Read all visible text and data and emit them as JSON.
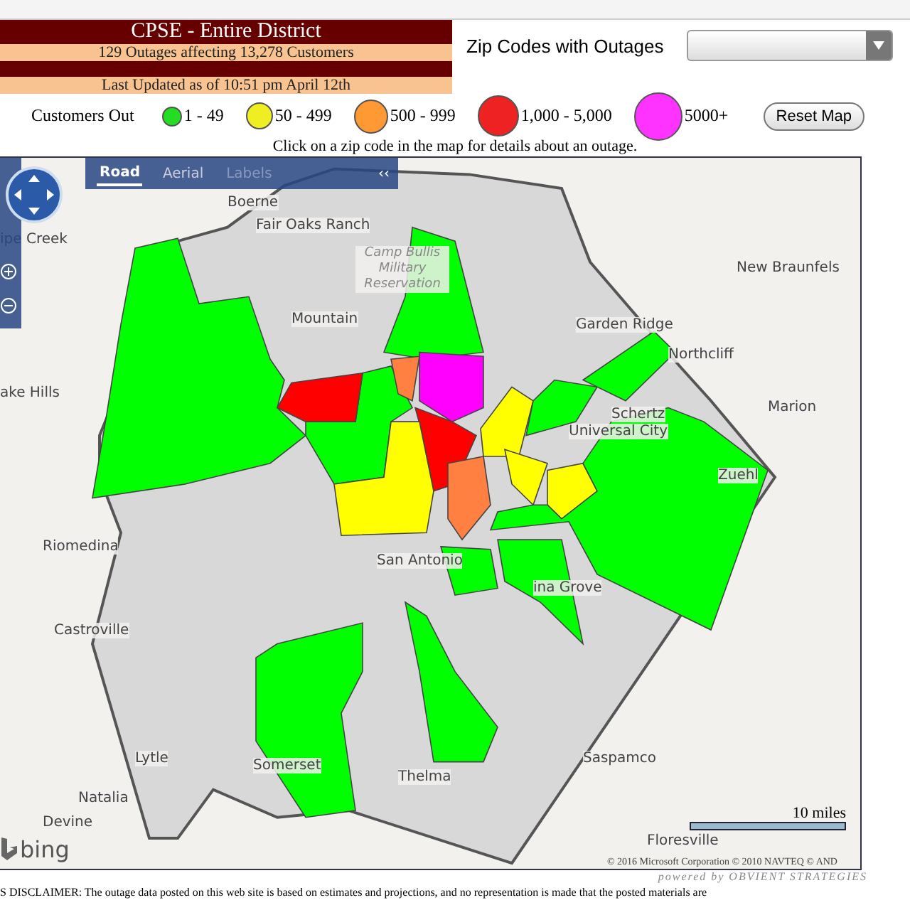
{
  "header": {
    "title": "CPSE - Entire District",
    "summary": "129 Outages affecting 13,278 Customers",
    "updated": "Last Updated as of 10:51 pm April 12th"
  },
  "zip_filter": {
    "label": "Zip Codes with Outages"
  },
  "legend": {
    "label": "Customers Out",
    "items": [
      {
        "label": "1 - 49",
        "color": "#22dd22"
      },
      {
        "label": "50 - 499",
        "color": "#eeee22"
      },
      {
        "label": "500 - 999",
        "color": "#ff9933"
      },
      {
        "label": "1,000 - 5,000",
        "color": "#ee2222"
      },
      {
        "label": "5000+",
        "color": "#ff33ff"
      }
    ]
  },
  "reset_button": "Reset Map",
  "instruction": "Click on a zip code in the map for details about an outage.",
  "map": {
    "tabs": [
      {
        "label": "Road",
        "selected": true
      },
      {
        "label": "Aerial",
        "selected": false
      },
      {
        "label": "Labels",
        "selected": false
      }
    ],
    "collapse": "‹‹",
    "zones": [
      {
        "color": "#00ff00"
      },
      {
        "color": "#00ff00"
      },
      {
        "color": "#00ff00"
      },
      {
        "color": "#ff0000"
      },
      {
        "color": "#ff8040"
      },
      {
        "color": "#ff00ff"
      },
      {
        "color": "#ff0000"
      },
      {
        "color": "#ffff00"
      },
      {
        "color": "#ff8040"
      },
      {
        "color": "#ffff00"
      },
      {
        "color": "#ffff00"
      },
      {
        "color": "#ffff00"
      },
      {
        "color": "#00ff00"
      },
      {
        "color": "#00ff00"
      },
      {
        "color": "#00ff00"
      },
      {
        "color": "#00ff00"
      },
      {
        "color": "#00ff00"
      },
      {
        "color": "#00ff00"
      },
      {
        "color": "#00ff00"
      }
    ],
    "labels": [
      "Boerne",
      "ipe Creek",
      "Fair Oaks Ranch",
      "Camp Bullis Military Reservation",
      "Mountain",
      "Garden Ridge",
      "New Braunfels",
      "Northcliff",
      "Marion",
      "Schertz",
      "Universal City",
      "Zuehl",
      "ake Hills",
      "Riomedina",
      "San Antonio",
      "Castroville",
      "ina Grove",
      "Saspamco",
      "Thelma",
      "Lytle",
      "Somerset",
      "Natalia",
      "Devine",
      "Floresville"
    ],
    "scale": "10 miles",
    "logo": "bing",
    "copyright": "© 2016 Microsoft Corporation   © 2010 NAVTEQ   © AND"
  },
  "powered_by": "powered by OBVIENT STRATEGIES",
  "disclaimer": "S DISCLAIMER: The outage data posted on this web site is based on estimates and projections, and no representation is made that the posted materials are"
}
